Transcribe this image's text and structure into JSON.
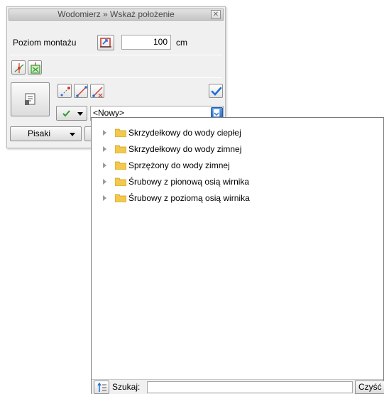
{
  "palette": {
    "title": "Wodomierz » Wskaż położenie",
    "close_glyph": "✕",
    "level_label": "Poziom montażu",
    "level_value": "100",
    "level_unit": "cm",
    "combo_value": "<Nowy>",
    "pens_label": "Pisaki"
  },
  "tree": {
    "items": [
      {
        "label": "Skrzydełkowy do wody ciepłej"
      },
      {
        "label": "Skrzydełkowy do wody zimnej"
      },
      {
        "label": "Sprzężony do wody zimnej"
      },
      {
        "label": "Śrubowy z pionową osią wirnika"
      },
      {
        "label": "Śrubowy z poziomą osią wirnika"
      }
    ],
    "search_label": "Szukaj:",
    "search_value": "",
    "clear_label": "Czyść"
  },
  "colors": {
    "accent_blue": "#1f6fd6",
    "check_green": "#2e9a2e",
    "folder_yellow": "#f2c94c",
    "icon_red": "#d23a2a"
  }
}
